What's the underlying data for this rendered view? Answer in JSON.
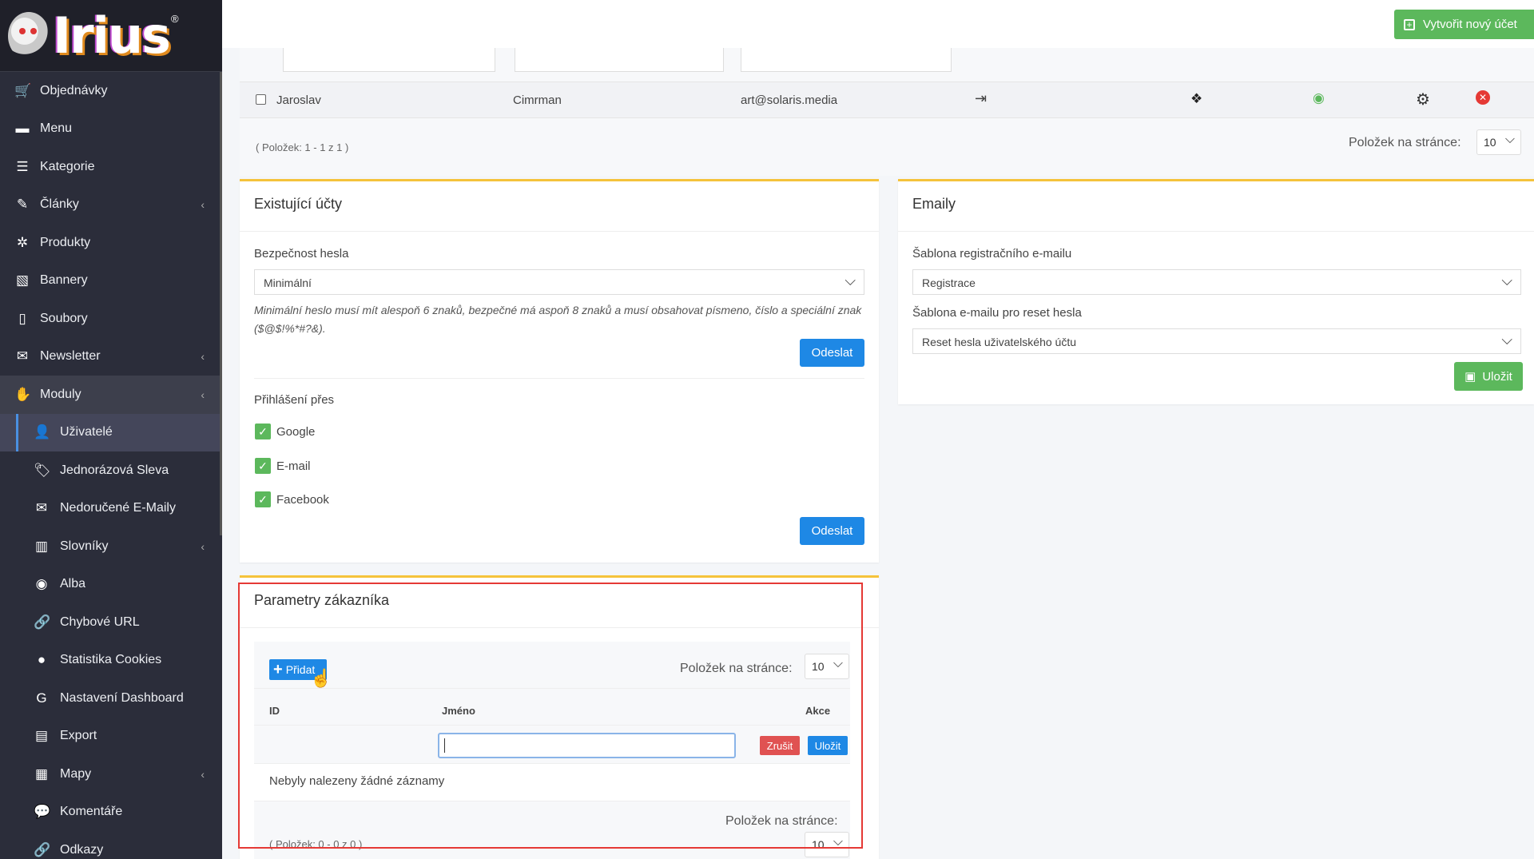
{
  "brand": {
    "name": "Irius",
    "mark": "®"
  },
  "sidebar": {
    "items": [
      {
        "label": "Objednávky",
        "icon": "cart-icon",
        "glyph": "🛒"
      },
      {
        "label": "Menu",
        "icon": "folder-icon",
        "glyph": "▬"
      },
      {
        "label": "Kategorie",
        "icon": "list-icon",
        "glyph": "☰"
      },
      {
        "label": "Články",
        "icon": "pencil-icon",
        "glyph": "✎",
        "chevron": "‹"
      },
      {
        "label": "Produkty",
        "icon": "aperture-icon",
        "glyph": "✲"
      },
      {
        "label": "Bannery",
        "icon": "image-icon",
        "glyph": "▧"
      },
      {
        "label": "Soubory",
        "icon": "file-icon",
        "glyph": "▯"
      },
      {
        "label": "Newsletter",
        "icon": "envelope-icon",
        "glyph": "✉",
        "chevron": "‹"
      },
      {
        "label": "Moduly",
        "icon": "handshake-icon",
        "glyph": "✋",
        "chevron": "‹"
      },
      {
        "label": "Uživatelé",
        "icon": "user-icon",
        "glyph": "👤"
      },
      {
        "label": "Jednorázová Sleva",
        "icon": "tags-icon",
        "glyph": "🏷"
      },
      {
        "label": "Nedoručené E-Maily",
        "icon": "mail-bulk-icon",
        "glyph": "✉"
      },
      {
        "label": "Slovníky",
        "icon": "books-icon",
        "glyph": "▥",
        "chevron": "‹"
      },
      {
        "label": "Alba",
        "icon": "camera-icon",
        "glyph": "◉"
      },
      {
        "label": "Chybové URL",
        "icon": "link-icon",
        "glyph": "🔗"
      },
      {
        "label": "Statistika Cookies",
        "icon": "cookie-icon",
        "glyph": "●"
      },
      {
        "label": "Nastavení Dashboard",
        "icon": "google-icon",
        "glyph": "G"
      },
      {
        "label": "Export",
        "icon": "file-export-icon",
        "glyph": "▤"
      },
      {
        "label": "Mapy",
        "icon": "map-icon",
        "glyph": "▦",
        "chevron": "‹"
      },
      {
        "label": "Komentáře",
        "icon": "comments-icon",
        "glyph": "💬"
      },
      {
        "label": "Odkazy",
        "icon": "link-icon",
        "glyph": "🔗"
      }
    ]
  },
  "topbar": {
    "create_label": "Vytvořit nový účet"
  },
  "users": {
    "row": {
      "first_name": "Jaroslav",
      "last_name": "Cimrman",
      "email": "art@solaris.media"
    },
    "pager_info": "( Položek: 1 - 1 z 1 )",
    "per_page_label": "Položek na stránce:",
    "per_page_value": "10"
  },
  "accounts": {
    "title": "Existující účty",
    "password_label": "Bezpečnost hesla",
    "password_value": "Minimální",
    "hint": "Minimální heslo musí mít alespoň 6 znaků, bezpečné má aspoň 8 znaků a musí obsahovat písmeno, číslo a speciální znak ($@$!%*#?&).",
    "submit_label": "Odeslat",
    "login_label": "Přihlášení přes",
    "providers": [
      "Google",
      "E-mail",
      "Facebook"
    ]
  },
  "emails": {
    "title": "Emaily",
    "reg_label": "Šablona registračního e-mailu",
    "reg_value": "Registrace",
    "reset_label": "Šablona e-mailu pro reset hesla",
    "reset_value": "Reset hesla uživatelského účtu",
    "save_label": "Uložit"
  },
  "params": {
    "title": "Parametry zákazníka",
    "add_label": "Přidat",
    "per_page_label": "Položek na stránce:",
    "per_page_value": "10",
    "col_id": "ID",
    "col_name": "Jméno",
    "col_actions": "Akce",
    "cancel_label": "Zrušit",
    "save_label": "Uložit",
    "empty_text": "Nebyly nalezeny žádné záznamy",
    "pager_info": "( Položek: 0 - 0 z 0 )"
  },
  "colors": {
    "accent": "#1e88e5",
    "success": "#5cb85c",
    "danger": "#e05252",
    "card_border": "#f5c33b",
    "sidebar": "#2b2d3a"
  }
}
